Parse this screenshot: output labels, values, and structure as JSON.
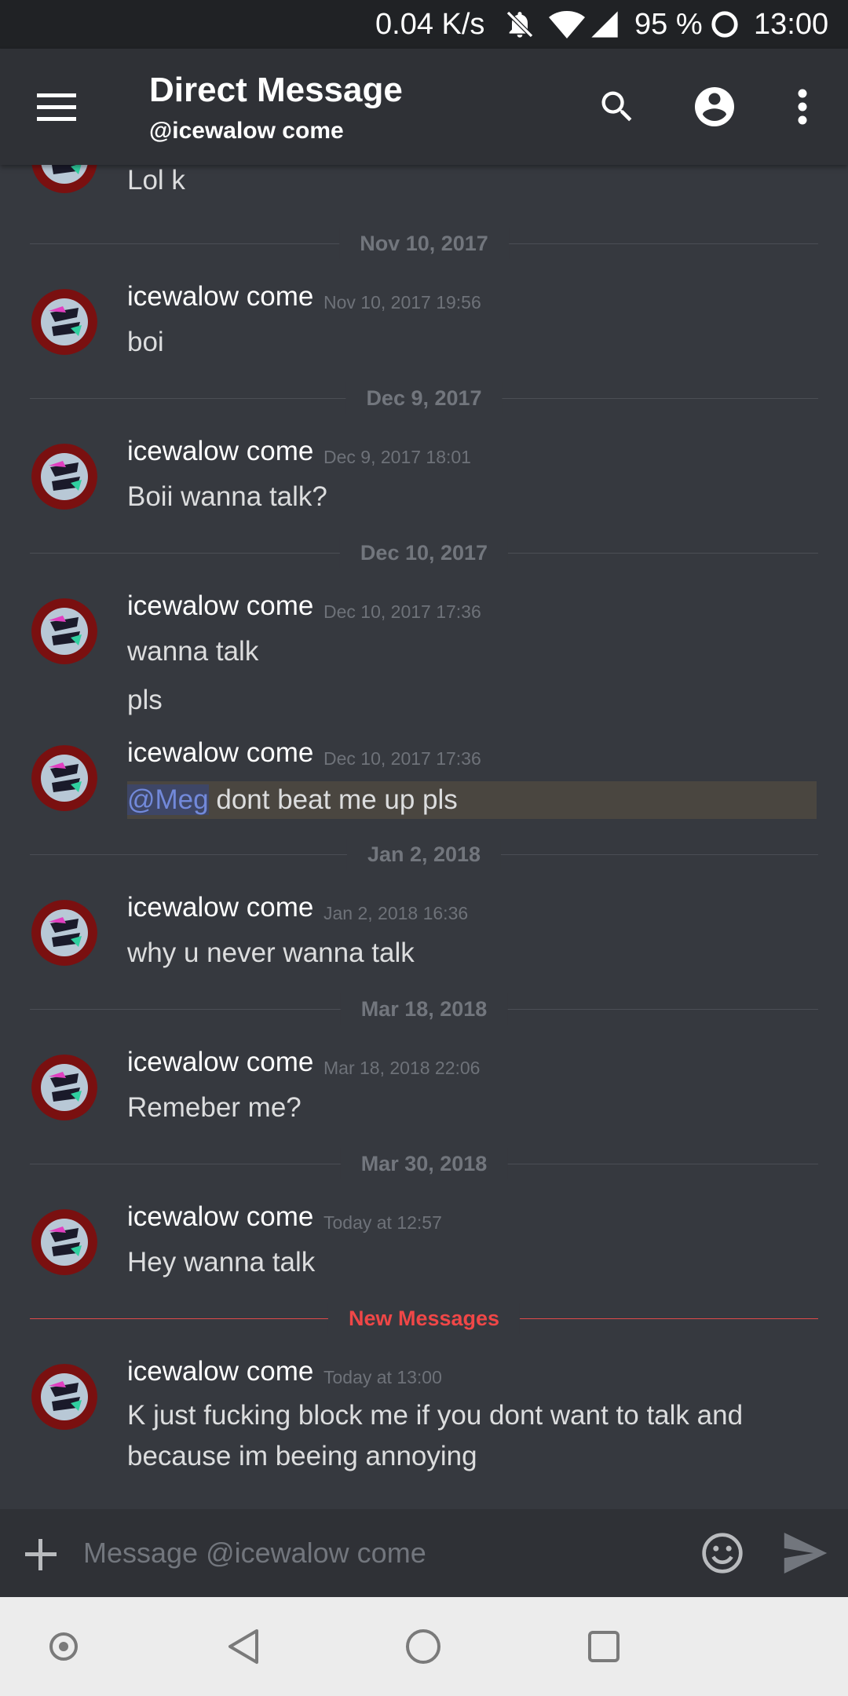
{
  "status_bar": {
    "speed": "0.04 K/s",
    "battery": "95 %",
    "time": "13:00"
  },
  "header": {
    "title": "Direct Message",
    "subtitle": "@icewalow come",
    "icons": [
      "menu-icon",
      "search-icon",
      "account-icon",
      "more-vert-icon"
    ]
  },
  "chat": {
    "partial_message": "Lol k",
    "dividers": [
      "Nov 10, 2017",
      "Dec 9, 2017",
      "Dec 10, 2017",
      "Jan 2, 2018",
      "Mar 18, 2018",
      "Mar 30, 2018"
    ],
    "new_messages_label": "New Messages",
    "groups": [
      {
        "author": "icewalow come",
        "time": "Nov 10, 2017 19:56",
        "lines": [
          "boi"
        ]
      },
      {
        "author": "icewalow come",
        "time": "Dec 9, 2017 18:01",
        "lines": [
          "Boii wanna talk?"
        ]
      },
      {
        "author": "icewalow come",
        "time": "Dec 10, 2017 17:36",
        "lines": [
          "wanna talk",
          "pls"
        ]
      },
      {
        "author": "icewalow come",
        "time": "Dec 10, 2017 17:36",
        "mention": "@Meg",
        "lines": [
          " dont beat me up pls"
        ]
      },
      {
        "author": "icewalow come",
        "time": "Jan 2, 2018 16:36",
        "lines": [
          "why u never wanna talk"
        ]
      },
      {
        "author": "icewalow come",
        "time": "Mar 18, 2018 22:06",
        "lines": [
          "Remeber me?"
        ]
      },
      {
        "author": "icewalow come",
        "time": "Today at 12:57",
        "lines": [
          "Hey wanna talk"
        ]
      },
      {
        "author": "icewalow come",
        "time": "Today at 13:00",
        "lines": [
          "K just fucking block me if you dont want to talk and because im beeing annoying"
        ]
      }
    ]
  },
  "composer": {
    "placeholder": "Message @icewalow come",
    "icons": [
      "add-icon",
      "emoji-icon",
      "send-icon"
    ]
  },
  "nav_bar": {
    "icons": [
      "nav-assist-icon",
      "nav-back-icon",
      "nav-home-icon",
      "nav-recents-icon"
    ]
  },
  "colors": {
    "background": "#36393f",
    "header": "#2f3136",
    "accent": "#7289da",
    "new_messages": "#f04747",
    "highlight": "#4a4640"
  }
}
